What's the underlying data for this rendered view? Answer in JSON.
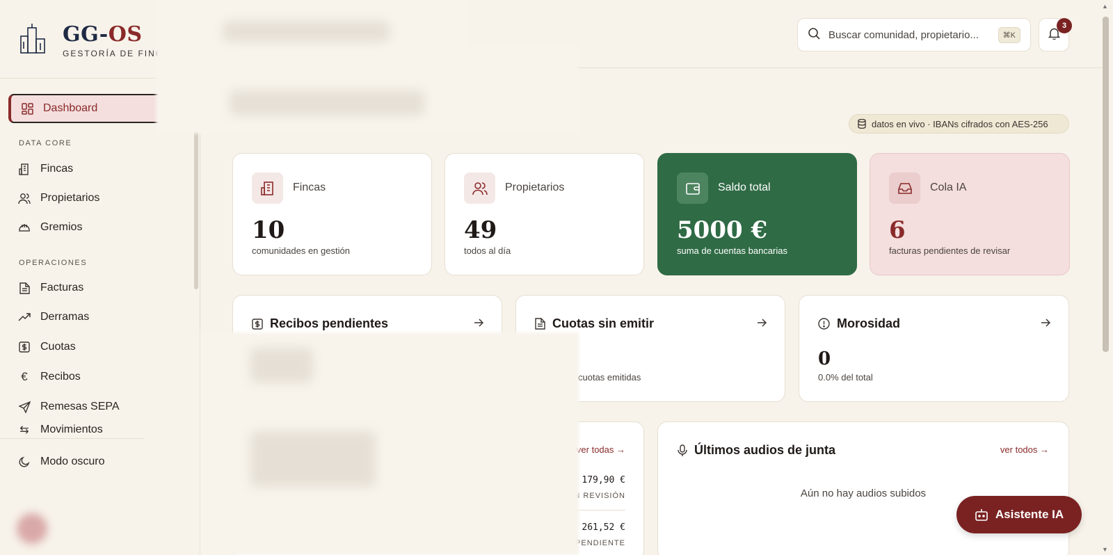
{
  "brand": {
    "name_main": "GG-",
    "name_accent": "OS",
    "subtitle": "GESTORÍA DE FINCA"
  },
  "sidebar": {
    "dashboard": "Dashboard",
    "section_data_core": "DATA CORE",
    "data_core_items": [
      "Fincas",
      "Propietarios",
      "Gremios"
    ],
    "section_operaciones": "OPERACIONES",
    "operaciones_items": [
      "Facturas",
      "Derramas",
      "Cuotas",
      "Recibos",
      "Remesas SEPA",
      "Movimientos"
    ],
    "dark_mode": "Modo oscuro"
  },
  "topbar": {
    "search_placeholder": "Buscar comunidad, propietario...",
    "search_shortcut": "⌘K",
    "notifications_count": "3"
  },
  "live_badge": "datos en vivo · IBANs cifrados con AES-256",
  "stats": [
    {
      "label": "Fincas",
      "value": "10",
      "sub": "comunidades en gestión",
      "icon": "building-icon"
    },
    {
      "label": "Propietarios",
      "value": "49",
      "sub": "todos al día",
      "icon": "users-icon"
    },
    {
      "label": "Saldo total",
      "value": "5000 €",
      "sub": "suma de cuentas bancarias",
      "icon": "wallet-icon"
    },
    {
      "label": "Cola IA",
      "value": "6",
      "sub": "facturas pendientes de revisar",
      "icon": "inbox-icon"
    }
  ],
  "mid_cards": [
    {
      "title": "Recibos pendientes",
      "value": "",
      "sub": ""
    },
    {
      "title": "Cuotas sin emitir",
      "value": "",
      "sub": "cuotas emitidas"
    },
    {
      "title": "Morosidad",
      "value": "0",
      "sub": "0.0% del total"
    }
  ],
  "facturas_card": {
    "link": "ver todas →",
    "rows": [
      {
        "amount": "179,90 €",
        "status": "N REVISIÓN"
      },
      {
        "amount": "261,52 €",
        "status": "PENDIENTE"
      }
    ]
  },
  "audios_card": {
    "title": "Últimos audios de junta",
    "link": "ver todos →",
    "empty": "Aún no hay audios subidos"
  },
  "ai_button": "Asistente IA",
  "colors": {
    "accent": "#8a2a2a",
    "green": "#2f6b45",
    "background": "#f7f3ea"
  }
}
